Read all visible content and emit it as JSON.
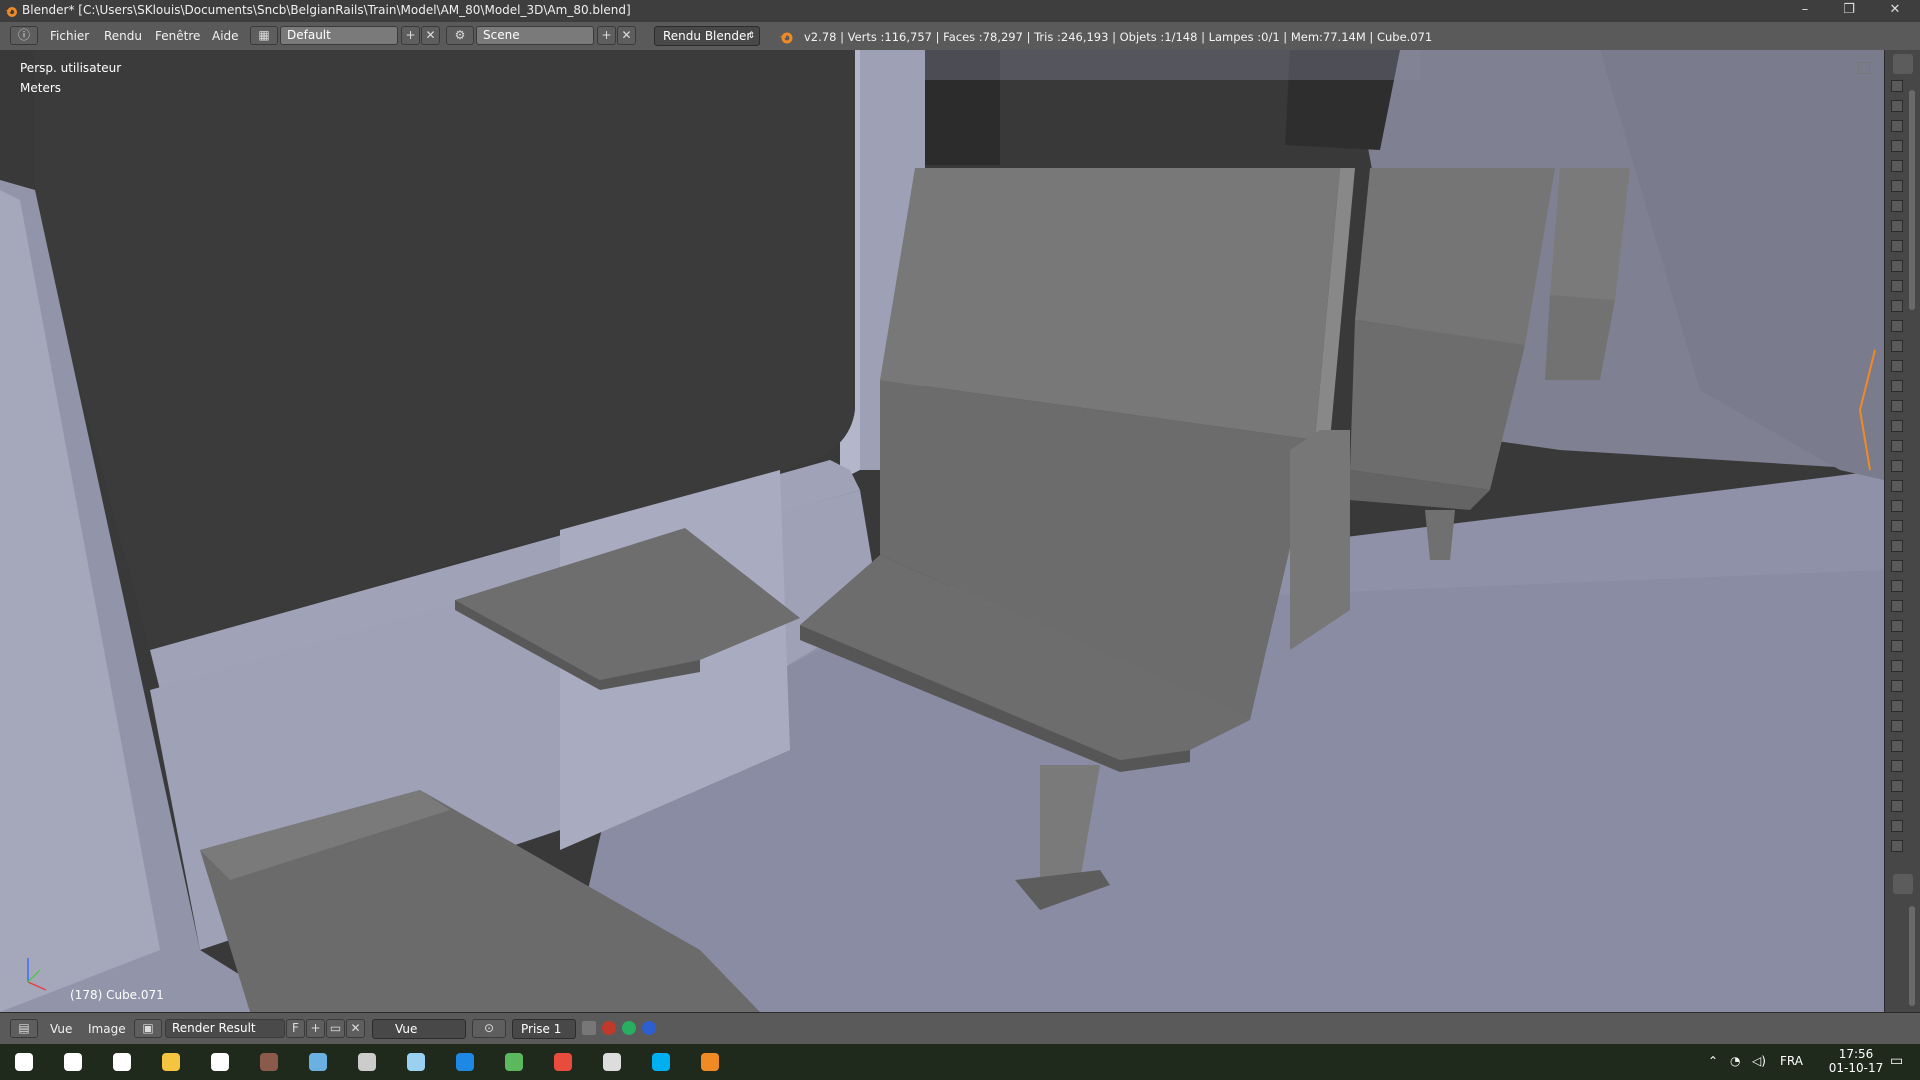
{
  "window": {
    "title": "Blender* [C:\\Users\\SKlouis\\Documents\\Sncb\\BelgianRails\\Train\\Model\\AM_80\\Model_3D\\Am_80.blend]",
    "minimize": "–",
    "maximize": "❐",
    "close": "✕"
  },
  "header": {
    "menus": [
      "Fichier",
      "Rendu",
      "Fenêtre",
      "Aide"
    ],
    "layout": "Default",
    "scene": "Scene",
    "render_engine": "Rendu Blender",
    "stats": "v2.78 | Verts :116,757 | Faces :78,297 | Tris :246,193 | Objets :1/148 | Lampes :0/1 | Mem:77.14M | Cube.071"
  },
  "viewport": {
    "view_name": "Persp. utilisateur",
    "units": "Meters",
    "active_object": "(178) Cube.071",
    "colors": {
      "background": "#393939",
      "mesh": "#8f91a6",
      "mesh_dark": "#6e7082",
      "mesh_light": "#a6a8bc"
    }
  },
  "bottom_header": {
    "menus": [
      "Vue",
      "Image"
    ],
    "image": "Render Result",
    "fake_user": "F",
    "view": "Vue",
    "slot": "Prise 1"
  },
  "taskbar": {
    "language": "FRA",
    "time": "17:56",
    "date": "01-10-17",
    "icons": [
      "windows-icon",
      "search-icon",
      "task-view-icon",
      "file-explorer-icon",
      "store-icon",
      "photo-app-icon",
      "paint-icon",
      "game-icon",
      "notepad-icon",
      "edge-icon",
      "utorrent-icon",
      "chrome-icon",
      "app-icon",
      "skype-icon",
      "blender-icon"
    ]
  }
}
